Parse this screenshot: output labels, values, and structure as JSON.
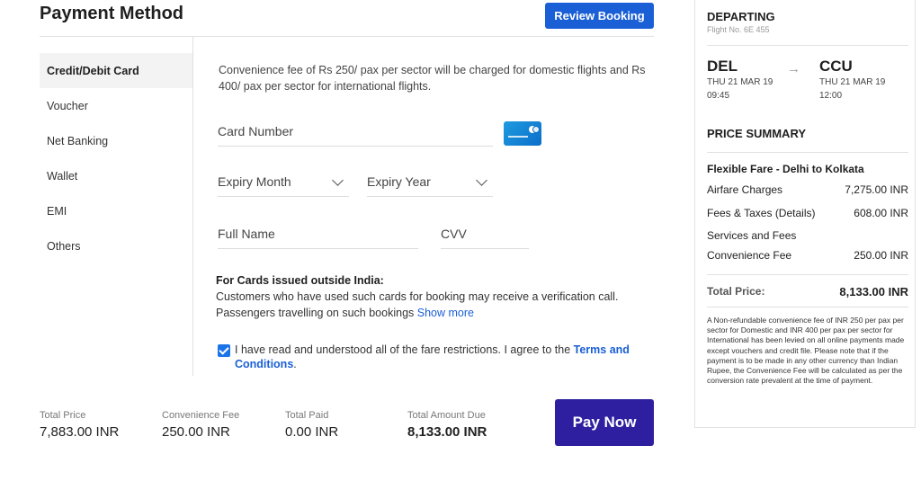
{
  "header": {
    "title": "Payment Method",
    "review_button": "Review Booking"
  },
  "payment_methods": [
    {
      "label": "Credit/Debit Card",
      "active": true
    },
    {
      "label": "Voucher",
      "active": false
    },
    {
      "label": "Net Banking",
      "active": false
    },
    {
      "label": "Wallet",
      "active": false
    },
    {
      "label": "EMI",
      "active": false
    },
    {
      "label": "Others",
      "active": false
    }
  ],
  "card_form": {
    "note": "Convenience fee of Rs 250/ pax per sector will be charged for domestic flights and Rs 400/ pax per sector for international flights.",
    "card_number_placeholder": "Card  Number",
    "expiry_month": "Expiry Month",
    "expiry_year": "Expiry Year",
    "full_name_placeholder": "Full Name",
    "cvv_placeholder": "CVV",
    "outside_heading": "For Cards issued outside India:",
    "outside_text": "Customers who have used such cards for booking may receive a verification call. Passengers travelling on such bookings",
    "show_more": "Show more",
    "agree_text": "I have read and understood all of the fare restrictions. I agree to the",
    "terms_link": "Terms and Conditions",
    "agree_end": "."
  },
  "totals": {
    "total_price_label": "Total Price",
    "total_price": "7,883.00 INR",
    "convenience_fee_label": "Convenience Fee",
    "convenience_fee": "250.00 INR",
    "total_paid_label": "Total Paid",
    "total_paid": "0.00 INR",
    "amount_due_label": "Total Amount Due",
    "amount_due": "8,133.00 INR",
    "pay_button": "Pay Now"
  },
  "summary": {
    "departing_label": "DEPARTING",
    "flight_no": "Flight No. 6E 455",
    "origin": "DEL",
    "origin_date": "THU 21 MAR 19",
    "origin_time": "09:45",
    "arrow": "→",
    "destination": "CCU",
    "dest_date": "THU 21 MAR 19",
    "dest_time": "12:00",
    "price_summary_label": "PRICE SUMMARY",
    "fare_title": "Flexible Fare - Delhi to Kolkata",
    "rows": [
      {
        "label": "Airfare Charges",
        "value": "7,275.00 INR"
      },
      {
        "label": "Fees & Taxes (Details)",
        "value": "608.00 INR"
      },
      {
        "label": "Services and Fees",
        "value": ""
      },
      {
        "label": "Convenience Fee",
        "value": "250.00 INR"
      }
    ],
    "total_label": "Total Price:",
    "total_value": "8,133.00 INR",
    "disclaimer": "A Non-refundable convenience fee of INR 250 per pax per sector for Domestic and INR 400 per pax per sector for International has been levied on all online payments made except vouchers and credit file. Please note that if the payment is to be made in any other currency than Indian Rupee, the Convenience Fee will be calculated as per the conversion rate prevalent at the time of payment."
  },
  "colors": {
    "accent_blue": "#1a5fd6",
    "pay_button": "#2d1fa0"
  }
}
